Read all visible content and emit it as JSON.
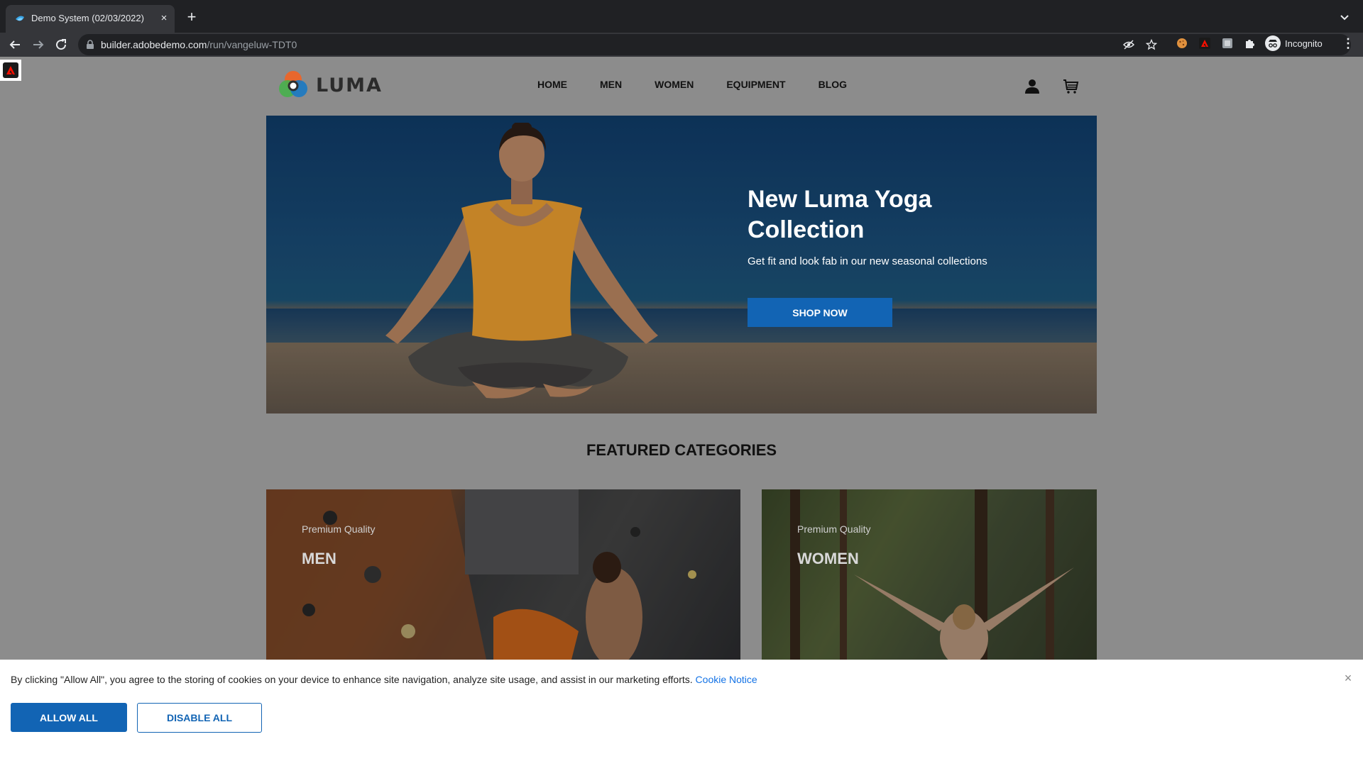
{
  "browser": {
    "tab_title": "Demo System (02/03/2022)",
    "tab_close": "×",
    "new_tab": "+",
    "url_domain": "builder.adobedemo.com",
    "url_path": "/run/vangeluw-TDT0",
    "profile_label": "Incognito",
    "menu_glyph": "⋮"
  },
  "site": {
    "logo_text": "LUMA",
    "nav": [
      "HOME",
      "MEN",
      "WOMEN",
      "EQUIPMENT",
      "BLOG"
    ]
  },
  "hero": {
    "title": "New Luma Yoga Collection",
    "subtitle": "Get fit and look fab in our new seasonal collections",
    "cta": "SHOP NOW"
  },
  "featured": {
    "title": "FEATURED CATEGORIES",
    "categories": [
      {
        "kicker": "Premium Quality",
        "name": "MEN"
      },
      {
        "kicker": "Premium Quality",
        "name": "WOMEN"
      }
    ]
  },
  "cookie_banner": {
    "text": "By clicking \"Allow All\", you agree to the storing of cookies on your device to enhance site navigation, analyze site usage, and assist in our marketing efforts.",
    "link": "Cookie Notice",
    "close": "×",
    "allow_label": "ALLOW ALL",
    "disable_label": "DISABLE ALL"
  },
  "colors": {
    "accent": "#1264b4",
    "link": "#1473e6",
    "chrome_dark": "#202124",
    "chrome_toolbar": "#35363a"
  },
  "icons": [
    "back-arrow-icon",
    "forward-arrow-icon",
    "reload-icon",
    "lock-icon",
    "eye-off-icon",
    "star-icon",
    "cookie-extension-icon",
    "adobe-extension-icon",
    "extension-icon",
    "puzzle-icon",
    "incognito-icon",
    "account-icon",
    "cart-icon",
    "close-icon"
  ]
}
